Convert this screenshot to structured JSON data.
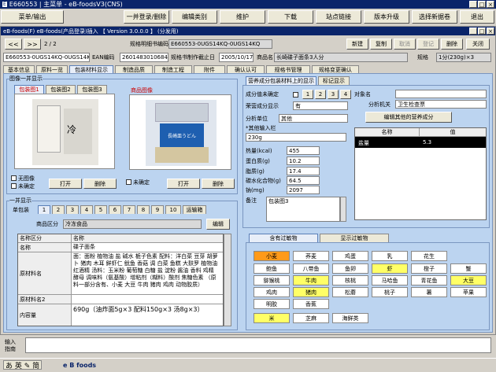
{
  "window": {
    "title": "E660553 | 主菜单 - eB-foodsV3(CNS)",
    "icon_text": "E",
    "controls": [
      "_",
      "□",
      "×"
    ]
  },
  "menubar": {
    "items": [
      "菜单/输出",
      "一并登录/删除",
      "编辑类别",
      "维护",
      "下载",
      "站点链接",
      "版本升级",
      "选择新据卷",
      "退出"
    ]
  },
  "subwindow": {
    "title": "eB-foods(F) eB-foods(产品登录)插入 【 Version 3.0.0.0 】 (分发用)",
    "controls": [
      "_",
      "□",
      "×"
    ]
  },
  "nav": {
    "prev": "<<",
    "next": ">>",
    "page": "2 / 2",
    "code_label": "规格明细书编码",
    "code_value": "E660553-0UGS14KQ-0UGS14KQ"
  },
  "actions": {
    "new": "新建",
    "copy": "复制",
    "cancel": "取消",
    "register": "登记",
    "delete": "删除",
    "close": "关闭"
  },
  "info": {
    "id_value": "E660553-0UGS14KQ-0UGS14KQ",
    "ean_label": "EAN编码",
    "ean_value": "2601483010684",
    "date_label": "规格书制作截止日",
    "date_value": "2005/10/17",
    "name_label": "商品名",
    "name_value": "长崎碟子面条3人分",
    "spec_label": "规格",
    "spec_value": "1分(230g)×3"
  },
  "tabs": [
    "基本信息",
    "原料一览",
    "包装材料显示",
    "制造品质",
    "制造工程",
    "附件",
    "确认认可",
    "规格书管理",
    "规格变更确认"
  ],
  "images": {
    "section_title": "图像一并显示",
    "pkg_tabs": [
      "包装图1",
      "包装图2",
      "包装图3"
    ],
    "no_image": "无图像",
    "unset": "未确定",
    "open": "打开",
    "delete": "删除",
    "product_title": "商品图像",
    "product_unset": "未确定",
    "product_open": "打开",
    "product_delete": "删除",
    "pkg_photo_text": "冷",
    "product_photo_text": "長崎皿うどん"
  },
  "display": {
    "section_title": "一并显示",
    "single_pkg": "单包装",
    "nums": [
      "1",
      "2",
      "3",
      "4",
      "5",
      "6",
      "7",
      "8",
      "9",
      "10"
    ],
    "assembled": "运输箱",
    "product_name_label": "商品区分",
    "product_name_value": "冷冻食品",
    "edit": "编辑",
    "table_head": [
      "名称区分",
      "名称"
    ],
    "rows": [
      {
        "key": "名称",
        "val": "碟子面条"
      },
      {
        "key": "原材料名",
        "val": "面：面粉 植物油 盐 碱水 栀子色素 配料：洋白菜 豆芽 胡萝卜 猪肉 木耳 鲜虾仁 鱿鱼 香菇 调 白菜 鱼糕 大麸罗 植物油 红酒精 汤料：玉米粉 葡萄糖 白糖 盐 淀粉 酱油 香料 鸡精 酵母 调味料（氨基酸）增粘剂（糊料）酸剂 焦糖色素 （原料一部分含有、小麦 大豆 牛肉 猪肉 鸡肉 动物胶质）"
      },
      {
        "key": "原材料名2",
        "val": ""
      },
      {
        "key": "内容量",
        "val": "690g（油炸面5g×3 配料150g×3 汤8g×3）"
      }
    ]
  },
  "nutrition": {
    "tab1": "营养成分包装材料上的显示",
    "tab2": "标记显示",
    "unset_label": "成分值未确定",
    "nums": [
      "1",
      "2",
      "3",
      "4"
    ],
    "show_label": "荣营成分显示",
    "show_value": "有",
    "unit_label": "分析单位",
    "unit_value": "其他",
    "other_label": "*其他输入栏",
    "other_value": "230g",
    "subject_label": "对象名",
    "subject_value": "",
    "org_label": "分析机关",
    "org_value": "卫生检查票",
    "edit_other": "编辑其他的营养成分",
    "items": [
      {
        "label": "热量(kcal)",
        "value": "455"
      },
      {
        "label": "蛋白质(g)",
        "value": "10.2"
      },
      {
        "label": "脂质(g)",
        "value": "17.4"
      },
      {
        "label": "碳水化合物(g)",
        "value": "64.5"
      },
      {
        "label": "钠(mg)",
        "value": "2097"
      }
    ],
    "note_label": "备注",
    "note_value": "包装图3",
    "grid_head": [
      "名称",
      "值"
    ],
    "grid_row": [
      "盐量",
      "5.3"
    ]
  },
  "allergens": {
    "tab1": "含有过敏物",
    "tab2": "显示过敏物",
    "rows": [
      [
        {
          "t": "小麦",
          "c": "o"
        },
        {
          "t": "荞麦",
          "c": ""
        },
        {
          "t": "鸡蛋",
          "c": ""
        },
        {
          "t": "乳",
          "c": ""
        },
        {
          "t": "花生",
          "c": ""
        }
      ],
      [
        {
          "t": "鲍鱼",
          "c": ""
        },
        {
          "t": "八带鱼",
          "c": ""
        },
        {
          "t": "鱼卵",
          "c": ""
        },
        {
          "t": "虾",
          "c": "y"
        },
        {
          "t": "橙子",
          "c": ""
        },
        {
          "t": "蟹",
          "c": ""
        }
      ],
      [
        {
          "t": "猕猴桃",
          "c": ""
        },
        {
          "t": "牛肉",
          "c": "y"
        },
        {
          "t": "核桃",
          "c": ""
        },
        {
          "t": "马哈鱼",
          "c": ""
        },
        {
          "t": "青花鱼",
          "c": ""
        },
        {
          "t": "大豆",
          "c": "y"
        }
      ],
      [
        {
          "t": "鸡肉",
          "c": ""
        },
        {
          "t": "猪肉",
          "c": "y"
        },
        {
          "t": "松蘑",
          "c": ""
        },
        {
          "t": "桃子",
          "c": ""
        },
        {
          "t": "薯",
          "c": ""
        },
        {
          "t": "苹果",
          "c": ""
        }
      ],
      [
        {
          "t": "明胶",
          "c": ""
        },
        {
          "t": "香蕉",
          "c": ""
        }
      ],
      [
        {
          "t": "米",
          "c": "y"
        },
        {
          "t": "芝麻",
          "c": ""
        },
        {
          "t": "海鲜类",
          "c": ""
        }
      ]
    ]
  },
  "input_guide": {
    "label1": "输入",
    "label2": "指南",
    "value": ""
  },
  "taskbar": {
    "ime": "あ 英 ✎ 简",
    "status": "e B  foods"
  }
}
